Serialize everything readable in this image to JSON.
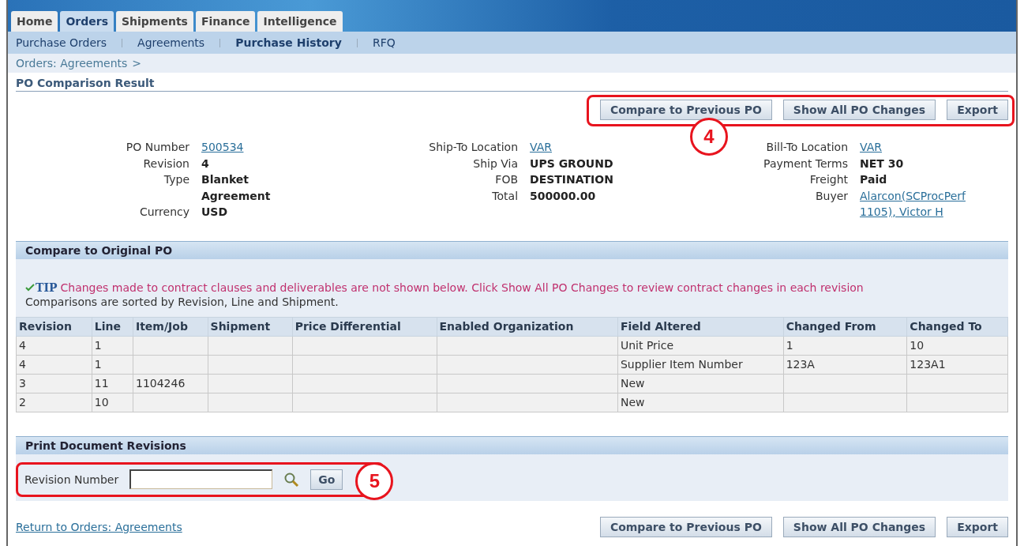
{
  "tabs": [
    {
      "label": "Home",
      "selected": false
    },
    {
      "label": "Orders",
      "selected": true
    },
    {
      "label": "Shipments",
      "selected": false
    },
    {
      "label": "Finance",
      "selected": false
    },
    {
      "label": "Intelligence",
      "selected": false
    }
  ],
  "subnav": [
    {
      "label": "Purchase Orders",
      "selected": false
    },
    {
      "label": "Agreements",
      "selected": false
    },
    {
      "label": "Purchase History",
      "selected": true
    },
    {
      "label": "RFQ",
      "selected": false
    }
  ],
  "breadcrumb": {
    "link": "Orders: Agreements",
    "separator": ">"
  },
  "page_title": "PO Comparison Result",
  "top_actions": {
    "buttons": [
      "Compare to Previous PO",
      "Show All PO Changes",
      "Export"
    ],
    "callout": "4"
  },
  "details": [
    [
      {
        "label": "PO Number",
        "value": "500534",
        "kind": "link"
      },
      {
        "label": "Revision",
        "value": "4",
        "kind": "bold"
      },
      {
        "label": "Type",
        "value": "Blanket Agreement",
        "kind": "bold"
      },
      {
        "label": "Currency",
        "value": "USD",
        "kind": "bold"
      }
    ],
    [
      {
        "label": "Ship-To Location",
        "value": "VAR",
        "kind": "link"
      },
      {
        "label": "Ship Via",
        "value": "UPS GROUND",
        "kind": "bold"
      },
      {
        "label": "FOB",
        "value": "DESTINATION",
        "kind": "bold"
      },
      {
        "label": "Total",
        "value": "500000.00",
        "kind": "bold"
      }
    ],
    [
      {
        "label": "Bill-To Location",
        "value": "VAR",
        "kind": "link"
      },
      {
        "label": "Payment Terms",
        "value": "NET 30",
        "kind": "bold"
      },
      {
        "label": "Freight",
        "value": "Paid",
        "kind": "bold"
      },
      {
        "label": "Buyer",
        "value": "Alarcon(SCProcPerf 1105), Victor H",
        "kind": "link"
      }
    ]
  ],
  "compare_section": {
    "title": "Compare to Original PO",
    "tip_label": "TIP",
    "tip": "Changes made to contract clauses and deliverables are not shown below. Click Show All PO Changes to review contract changes in each revision",
    "note": "Comparisons are sorted by Revision, Line and Shipment.",
    "table": {
      "columns": [
        "Revision",
        "Line",
        "Item/Job",
        "Shipment",
        "Price Differential",
        "Enabled Organization",
        "Field Altered",
        "Changed From",
        "Changed To"
      ],
      "rows": [
        [
          "4",
          "1",
          "",
          "",
          "",
          "",
          "Unit Price",
          "1",
          "10"
        ],
        [
          "4",
          "1",
          "",
          "",
          "",
          "",
          "Supplier Item Number",
          "123A",
          "123A1"
        ],
        [
          "3",
          "11",
          "1104246",
          "",
          "",
          "",
          "New",
          "",
          ""
        ],
        [
          "2",
          "10",
          "",
          "",
          "",
          "",
          "New",
          "",
          ""
        ]
      ]
    }
  },
  "print_section": {
    "title": "Print Document Revisions",
    "field_label": "Revision Number",
    "button": "Go",
    "callout": "5"
  },
  "return_link": "Return to Orders: Agreements",
  "bottom_buttons": [
    "Compare to Previous PO",
    "Show All PO Changes",
    "Export"
  ]
}
